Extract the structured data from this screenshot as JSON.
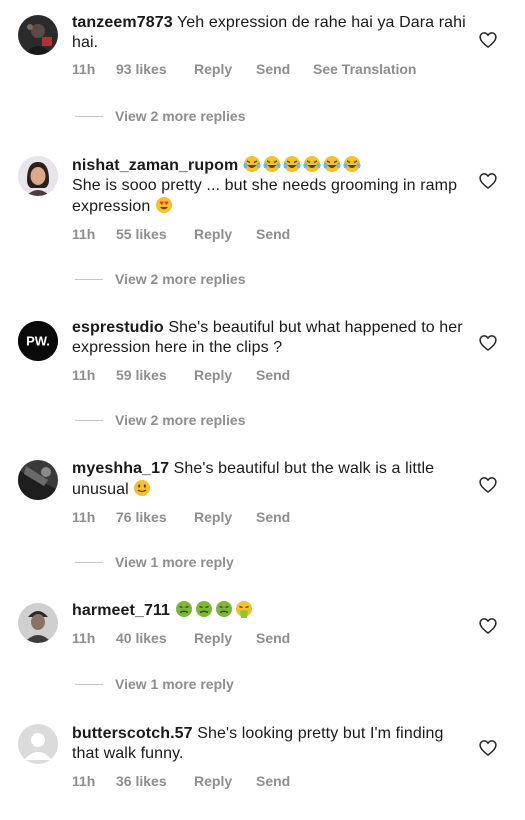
{
  "comments": [
    {
      "username": "tanzeem7873",
      "text": "Yeh expression de rahe hai ya Dara rahi hai.",
      "time": "11h",
      "likes": "93 likes",
      "reply": "Reply",
      "send": "Send",
      "translate": "See Translation",
      "more_replies": "View 2 more replies"
    },
    {
      "username": "nishat_zaman_rupom",
      "text": "She is sooo pretty ... but she needs grooming in ramp expression",
      "time": "11h",
      "likes": "55 likes",
      "reply": "Reply",
      "send": "Send",
      "more_replies": "View 2 more replies",
      "emojis_after_username": [
        "laughing-tears",
        "laughing-tears",
        "laughing-tears",
        "laughing-tears",
        "laughing-tears",
        "laughing-tears"
      ],
      "emojis_after_text": [
        "heart-eyes"
      ]
    },
    {
      "username": "esprestudio",
      "text": "She's beautiful but what happened to her expression here in the clips ?",
      "avatar_text": "PW.",
      "time": "11h",
      "likes": "59 likes",
      "reply": "Reply",
      "send": "Send",
      "more_replies": "View 2 more replies"
    },
    {
      "username": "myeshha_17",
      "text": "She's beautiful but the walk is a little unusual",
      "time": "11h",
      "likes": "76 likes",
      "reply": "Reply",
      "send": "Send",
      "more_replies": "View 1 more reply",
      "emojis_after_text": [
        "slightly-smiling"
      ]
    },
    {
      "username": "harmeet_711",
      "text": "",
      "time": "11h",
      "likes": "40 likes",
      "reply": "Reply",
      "send": "Send",
      "more_replies": "View 1 more reply",
      "emojis_after_username": [
        "nauseated",
        "nauseated",
        "nauseated",
        "vomiting"
      ]
    },
    {
      "username": "butterscotch.57",
      "text": "She's looking pretty but I'm finding that walk funny.",
      "time": "11h",
      "likes": "36 likes",
      "reply": "Reply",
      "send": "Send"
    }
  ],
  "colors": {
    "text": "#1a1a1a",
    "meta": "#8e8e8e",
    "divider": "#c7c7c7",
    "emoji_yellow": "#f5c02a",
    "emoji_green": "#7fb53a"
  }
}
